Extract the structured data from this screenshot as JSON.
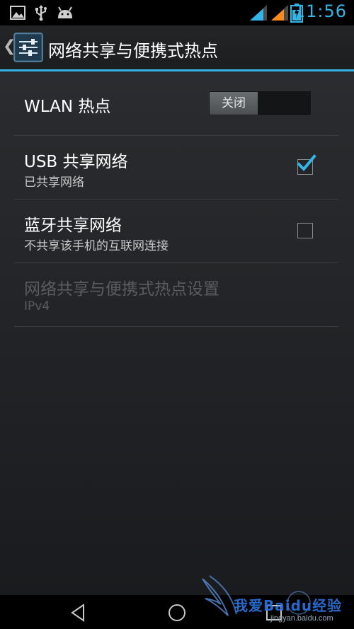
{
  "status_bar": {
    "time": "11:56",
    "icons": [
      "image-icon",
      "usb-icon",
      "android-icon",
      "signal-icon",
      "signal-weak-icon",
      "battery-icon"
    ]
  },
  "action_bar": {
    "title": "网络共享与便携式热点"
  },
  "settings": {
    "wlan_hotspot": {
      "title": "WLAN 热点",
      "toggle_label": "关闭",
      "enabled": false
    },
    "usb_tethering": {
      "title": "USB 共享网络",
      "summary": "已共享网络",
      "checked": true
    },
    "bluetooth_tethering": {
      "title": "蓝牙共享网络",
      "summary": "不共享该手机的互联网连接",
      "checked": false
    },
    "hotspot_settings": {
      "title": "网络共享与便携式热点设置",
      "summary": "IPv4",
      "disabled": true
    }
  },
  "nav_bar": {
    "buttons": [
      "back",
      "home",
      "recent-apps"
    ]
  },
  "watermark": {
    "text": "我爱Baidu经验",
    "url": "jingyan.baidu.com"
  },
  "colors": {
    "accent": "#33b5e5",
    "background": "#1f2124",
    "text_secondary": "#c8c8c8"
  }
}
